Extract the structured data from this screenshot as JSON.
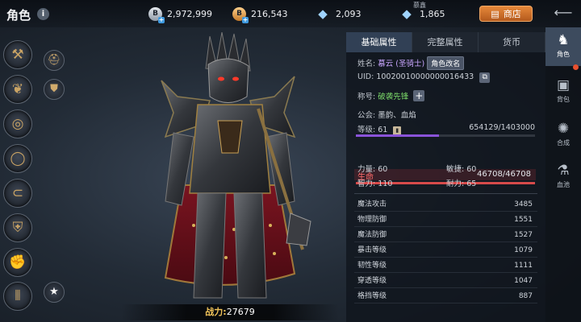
{
  "header": {
    "title": "角色",
    "info_icon": "i"
  },
  "currencies": {
    "silver": {
      "icon": "silver-coin-icon",
      "symbol": "B",
      "value": "2,972,999"
    },
    "gold": {
      "icon": "gold-coin-icon",
      "symbol": "B",
      "value": "216,543"
    },
    "diamond": {
      "icon": "diamond-icon",
      "symbol": "◆",
      "value": "2,093"
    },
    "bound_diamond": {
      "icon": "bound-diamond-icon",
      "symbol": "◆",
      "label": "慕鑫",
      "value": "1,865"
    },
    "plus": "+"
  },
  "shop": {
    "label": "商店",
    "icon": "shop-icon"
  },
  "equipment": {
    "left": [
      {
        "name": "hammer-icon",
        "glyph": "⚒"
      },
      {
        "name": "earrings-icon",
        "glyph": "❦"
      },
      {
        "name": "necklace-icon",
        "glyph": "◎"
      },
      {
        "name": "ring-icon",
        "glyph": "◯"
      },
      {
        "name": "bracelet-icon",
        "glyph": "⊂"
      },
      {
        "name": "chest-armor-icon",
        "glyph": "⛨"
      },
      {
        "name": "gauntlet-icon",
        "glyph": "✊"
      },
      {
        "name": "boots-icon",
        "glyph": "⫴"
      }
    ],
    "right": [
      {
        "name": "helmet-icon",
        "glyph": "⛑"
      },
      {
        "name": "shoulder-icon",
        "glyph": "⛊"
      },
      {
        "name": "star-icon",
        "glyph": "★"
      }
    ]
  },
  "power": {
    "label": "战力:",
    "value": "27679"
  },
  "tabs": [
    "基础属性",
    "完整属性",
    "货币"
  ],
  "profile": {
    "name_label": "姓名:",
    "name_value": "慕云 (圣骑士)",
    "rename_button": "角色改名",
    "uid_label": "UID:",
    "uid_value": "10020010000000016433",
    "title_label": "称号:",
    "title_value": "破袭先锋",
    "guild_label": "公会:",
    "guild_value": "墨韵、血焰",
    "level_label": "等级:",
    "level_value": "61",
    "exp_value": "654129/1403000",
    "exp_fraction": 0.466,
    "hp_label": "生命",
    "hp_value": "46708/46708",
    "hp_fraction": 1.0
  },
  "attributes": [
    {
      "label": "力量:",
      "value": "60"
    },
    {
      "label": "敏捷:",
      "value": "60"
    },
    {
      "label": "智力:",
      "value": "110"
    },
    {
      "label": "耐力:",
      "value": "65"
    }
  ],
  "stats": [
    {
      "label": "魔法攻击",
      "value": "3485"
    },
    {
      "label": "物理防御",
      "value": "1551"
    },
    {
      "label": "魔法防御",
      "value": "1527"
    },
    {
      "label": "暴击等级",
      "value": "1079"
    },
    {
      "label": "韧性等级",
      "value": "1111"
    },
    {
      "label": "穿透等级",
      "value": "1047"
    },
    {
      "label": "格挡等级",
      "value": "887"
    }
  ],
  "nav": [
    {
      "label": "角色",
      "icon": "role-icon",
      "glyph": "♞"
    },
    {
      "label": "背包",
      "icon": "bag-icon",
      "glyph": "▣"
    },
    {
      "label": "合成",
      "icon": "synthesis-icon",
      "glyph": "✺"
    },
    {
      "label": "血池",
      "icon": "blood-pool-icon",
      "glyph": "⚗"
    }
  ],
  "colors": {
    "accent": "#e6883a",
    "exp": "#8a53d9",
    "hp": "#d64a4a",
    "power": "#f2c45a"
  }
}
